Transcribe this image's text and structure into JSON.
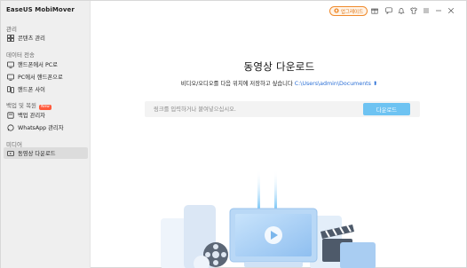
{
  "app": {
    "title": "EaseUS MobiMover"
  },
  "sidebar": {
    "sections": [
      {
        "title": "관리",
        "items": [
          {
            "label": "콘텐츠 관리",
            "icon": "grid-icon"
          }
        ]
      },
      {
        "title": "데이터 전송",
        "items": [
          {
            "label": "핸드폰에서 PC로",
            "icon": "phone-to-pc-icon"
          },
          {
            "label": "PC에서 핸드폰으로",
            "icon": "pc-to-phone-icon"
          },
          {
            "label": "핸드폰 사이",
            "icon": "phone-to-phone-icon"
          }
        ]
      },
      {
        "title": "백업 및 복원",
        "badge": "New",
        "items": [
          {
            "label": "백업 관리자",
            "icon": "backup-icon"
          },
          {
            "label": "WhatsApp 관리자",
            "icon": "whatsapp-icon"
          }
        ]
      },
      {
        "title": "미디어",
        "items": [
          {
            "label": "동영상 다운로드",
            "icon": "video-download-icon",
            "active": true
          }
        ]
      }
    ]
  },
  "topbar": {
    "upgrade_label": "업그레이드",
    "icons": [
      "gift-icon",
      "chat-icon",
      "bell-icon",
      "shirt-icon",
      "menu-icon",
      "minimize-icon",
      "close-icon"
    ]
  },
  "main": {
    "title": "동영상 다운로드",
    "subtitle": "비디오/오디오를 다음 위치에 저장하고 싶습니다",
    "save_path": "C:\\Users\\admin\\Documents",
    "url_placeholder": "링크를 입력하거나 붙여넣으십시오.",
    "download_button": "다운로드"
  },
  "colors": {
    "accent": "#6ec3f2",
    "upgrade": "#f08a2b",
    "path": "#2a6fd6",
    "sidebar_bg": "#efefef"
  }
}
